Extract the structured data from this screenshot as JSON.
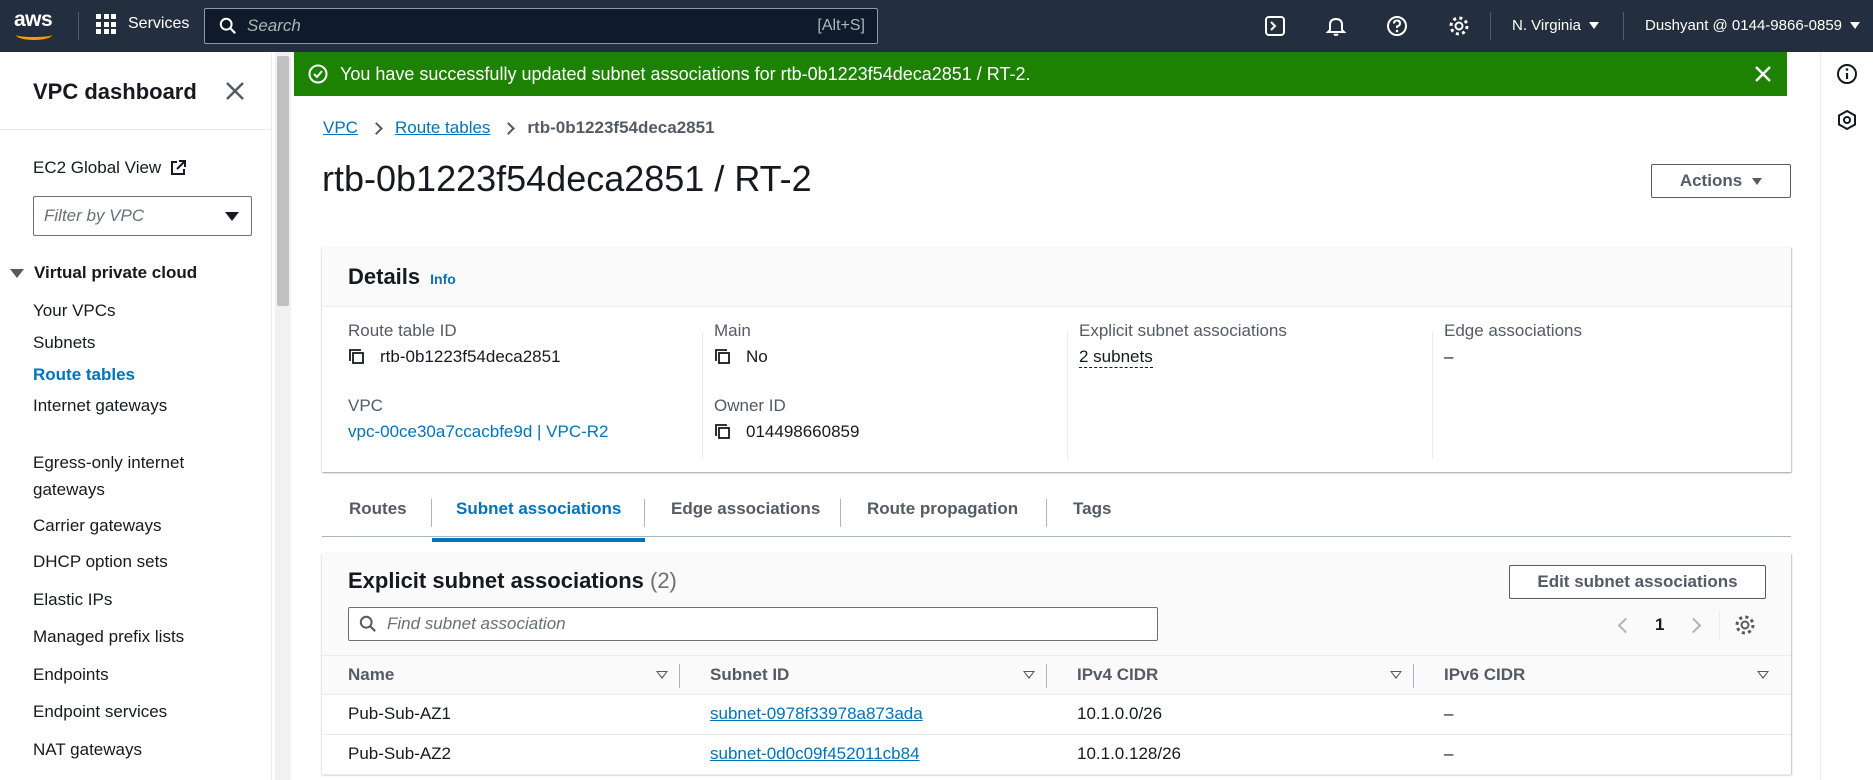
{
  "topnav": {
    "logo_text": "aws",
    "services_label": "Services",
    "search_placeholder": "Search",
    "search_shortcut": "[Alt+S]",
    "region": "N. Virginia",
    "account": "Dushyant @ 0144-9866-0859",
    "icons": [
      "cloudshell-icon",
      "bell-icon",
      "help-icon",
      "settings-icon"
    ]
  },
  "flash": {
    "message": "You have successfully updated subnet associations for rtb-0b1223f54deca2851 / RT-2.",
    "color": "#1d8102"
  },
  "sidebar": {
    "title": "VPC dashboard",
    "global_view": "EC2 Global View",
    "filter_placeholder": "Filter by VPC",
    "section": "Virtual private cloud",
    "items": [
      {
        "label": "Your VPCs"
      },
      {
        "label": "Subnets"
      },
      {
        "label": "Route tables",
        "active": true
      },
      {
        "label": "Internet gateways"
      },
      {
        "label": "Egress-only internet gateways"
      },
      {
        "label": "Carrier gateways"
      },
      {
        "label": "DHCP option sets"
      },
      {
        "label": "Elastic IPs"
      },
      {
        "label": "Managed prefix lists"
      },
      {
        "label": "Endpoints"
      },
      {
        "label": "Endpoint services"
      },
      {
        "label": "NAT gateways"
      }
    ]
  },
  "breadcrumb": {
    "items": [
      "VPC",
      "Route tables"
    ],
    "current": "rtb-0b1223f54deca2851"
  },
  "page": {
    "title": "rtb-0b1223f54deca2851 / RT-2",
    "actions_label": "Actions"
  },
  "details": {
    "title": "Details",
    "info": "Info",
    "route_table_id_label": "Route table ID",
    "route_table_id": "rtb-0b1223f54deca2851",
    "main_label": "Main",
    "main": "No",
    "explicit_label": "Explicit subnet associations",
    "explicit": "2 subnets",
    "edge_label": "Edge associations",
    "edge": "–",
    "vpc_label": "VPC",
    "vpc": "vpc-00ce30a7ccacbfe9d | VPC-R2",
    "owner_label": "Owner ID",
    "owner": "014498660859"
  },
  "tabs": [
    "Routes",
    "Subnet associations",
    "Edge associations",
    "Route propagation",
    "Tags"
  ],
  "assoc": {
    "title": "Explicit subnet associations",
    "count": "(2)",
    "edit_label": "Edit subnet associations",
    "find_placeholder": "Find subnet association",
    "page": "1",
    "columns": [
      "Name",
      "Subnet ID",
      "IPv4 CIDR",
      "IPv6 CIDR"
    ],
    "rows": [
      {
        "name": "Pub-Sub-AZ1",
        "subnet_id": "subnet-0978f33978a873ada",
        "ipv4": "10.1.0.0/26",
        "ipv6": "–"
      },
      {
        "name": "Pub-Sub-AZ2",
        "subnet_id": "subnet-0d0c09f452011cb84",
        "ipv4": "10.1.0.128/26",
        "ipv6": "–"
      }
    ]
  }
}
